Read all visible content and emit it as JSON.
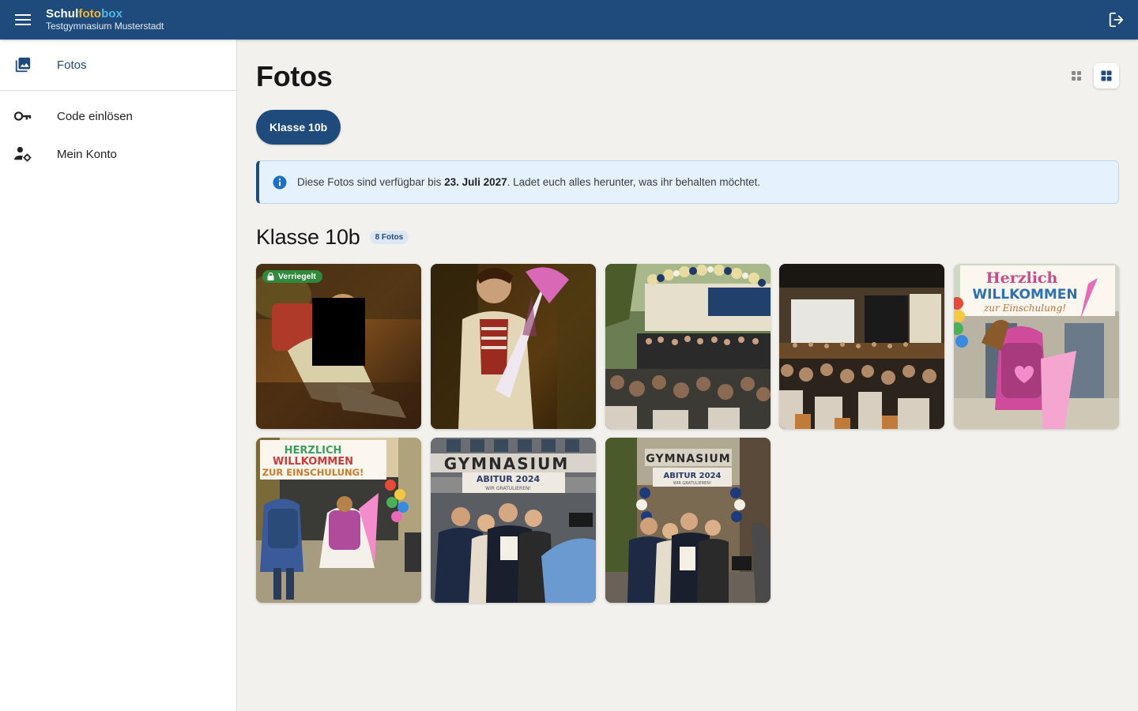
{
  "appbar": {
    "brand_part1": "Schul",
    "brand_part2": "foto",
    "brand_part3": "box",
    "school_name": "Testgymnasium Musterstadt",
    "menu_icon": "hamburger-menu-icon",
    "logout_icon": "logout-icon"
  },
  "sidebar": {
    "items": [
      {
        "label": "Fotos",
        "icon": "photo-library-icon",
        "active": true
      },
      {
        "label": "Code einlösen",
        "icon": "key-icon",
        "active": false
      },
      {
        "label": "Mein Konto",
        "icon": "account-settings-icon",
        "active": false
      }
    ]
  },
  "main": {
    "title": "Fotos",
    "view_toggle": [
      {
        "icon": "grid-small-icon",
        "active": false
      },
      {
        "icon": "grid-large-icon",
        "active": true
      }
    ],
    "class_chip": "Klasse 10b",
    "info": {
      "icon": "info-icon",
      "text_before": "Diese Fotos sind verfügbar bis ",
      "date": "23. Juli 2027",
      "text_after": ". Ladet euch alles herunter, was ihr behalten möchtet."
    },
    "section": {
      "title": "Klasse 10b",
      "count_badge": "8 Fotos"
    },
    "photos": [
      {
        "locked": true,
        "lock_label": "Verriegelt",
        "subject": "child-with-school-bag-vintage"
      },
      {
        "locked": false,
        "subject": "boy-with-school-cone-vintage"
      },
      {
        "locked": false,
        "subject": "graduation-ceremony-balloons"
      },
      {
        "locked": false,
        "subject": "auditorium-stage-audience"
      },
      {
        "locked": false,
        "subject": "girl-with-backpack-welcome-banner",
        "banner_text": [
          "Herzlich",
          "WILLKOMMEN",
          "zur Einschulung!"
        ]
      },
      {
        "locked": false,
        "subject": "children-walking-welcome-banner",
        "banner_text": [
          "HERZLICH",
          "WILLKOMMEN",
          "ZUR EINSCHULUNG!"
        ]
      },
      {
        "locked": false,
        "subject": "family-graduation-photo",
        "banner_text": [
          "GYMNASIUM",
          "ABITUR 2024",
          "WIR GRATULIEREN!"
        ]
      },
      {
        "locked": false,
        "subject": "family-graduation-photo-balloons",
        "banner_text": [
          "GYMNASIUM",
          "ABITUR 2024",
          "WIR GRATULIEREN!"
        ]
      }
    ]
  }
}
